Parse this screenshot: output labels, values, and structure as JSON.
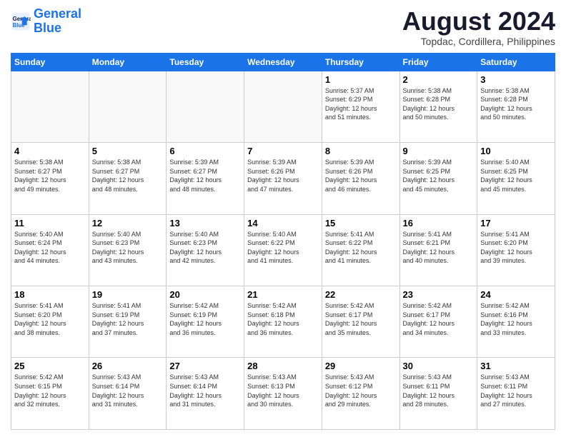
{
  "logo": {
    "line1": "General",
    "line2": "Blue"
  },
  "title": "August 2024",
  "subtitle": "Topdac, Cordillera, Philippines",
  "weekdays": [
    "Sunday",
    "Monday",
    "Tuesday",
    "Wednesday",
    "Thursday",
    "Friday",
    "Saturday"
  ],
  "weeks": [
    [
      {
        "day": "",
        "info": ""
      },
      {
        "day": "",
        "info": ""
      },
      {
        "day": "",
        "info": ""
      },
      {
        "day": "",
        "info": ""
      },
      {
        "day": "1",
        "info": "Sunrise: 5:37 AM\nSunset: 6:29 PM\nDaylight: 12 hours\nand 51 minutes."
      },
      {
        "day": "2",
        "info": "Sunrise: 5:38 AM\nSunset: 6:28 PM\nDaylight: 12 hours\nand 50 minutes."
      },
      {
        "day": "3",
        "info": "Sunrise: 5:38 AM\nSunset: 6:28 PM\nDaylight: 12 hours\nand 50 minutes."
      }
    ],
    [
      {
        "day": "4",
        "info": "Sunrise: 5:38 AM\nSunset: 6:27 PM\nDaylight: 12 hours\nand 49 minutes."
      },
      {
        "day": "5",
        "info": "Sunrise: 5:38 AM\nSunset: 6:27 PM\nDaylight: 12 hours\nand 48 minutes."
      },
      {
        "day": "6",
        "info": "Sunrise: 5:39 AM\nSunset: 6:27 PM\nDaylight: 12 hours\nand 48 minutes."
      },
      {
        "day": "7",
        "info": "Sunrise: 5:39 AM\nSunset: 6:26 PM\nDaylight: 12 hours\nand 47 minutes."
      },
      {
        "day": "8",
        "info": "Sunrise: 5:39 AM\nSunset: 6:26 PM\nDaylight: 12 hours\nand 46 minutes."
      },
      {
        "day": "9",
        "info": "Sunrise: 5:39 AM\nSunset: 6:25 PM\nDaylight: 12 hours\nand 45 minutes."
      },
      {
        "day": "10",
        "info": "Sunrise: 5:40 AM\nSunset: 6:25 PM\nDaylight: 12 hours\nand 45 minutes."
      }
    ],
    [
      {
        "day": "11",
        "info": "Sunrise: 5:40 AM\nSunset: 6:24 PM\nDaylight: 12 hours\nand 44 minutes."
      },
      {
        "day": "12",
        "info": "Sunrise: 5:40 AM\nSunset: 6:23 PM\nDaylight: 12 hours\nand 43 minutes."
      },
      {
        "day": "13",
        "info": "Sunrise: 5:40 AM\nSunset: 6:23 PM\nDaylight: 12 hours\nand 42 minutes."
      },
      {
        "day": "14",
        "info": "Sunrise: 5:40 AM\nSunset: 6:22 PM\nDaylight: 12 hours\nand 41 minutes."
      },
      {
        "day": "15",
        "info": "Sunrise: 5:41 AM\nSunset: 6:22 PM\nDaylight: 12 hours\nand 41 minutes."
      },
      {
        "day": "16",
        "info": "Sunrise: 5:41 AM\nSunset: 6:21 PM\nDaylight: 12 hours\nand 40 minutes."
      },
      {
        "day": "17",
        "info": "Sunrise: 5:41 AM\nSunset: 6:20 PM\nDaylight: 12 hours\nand 39 minutes."
      }
    ],
    [
      {
        "day": "18",
        "info": "Sunrise: 5:41 AM\nSunset: 6:20 PM\nDaylight: 12 hours\nand 38 minutes."
      },
      {
        "day": "19",
        "info": "Sunrise: 5:41 AM\nSunset: 6:19 PM\nDaylight: 12 hours\nand 37 minutes."
      },
      {
        "day": "20",
        "info": "Sunrise: 5:42 AM\nSunset: 6:19 PM\nDaylight: 12 hours\nand 36 minutes."
      },
      {
        "day": "21",
        "info": "Sunrise: 5:42 AM\nSunset: 6:18 PM\nDaylight: 12 hours\nand 36 minutes."
      },
      {
        "day": "22",
        "info": "Sunrise: 5:42 AM\nSunset: 6:17 PM\nDaylight: 12 hours\nand 35 minutes."
      },
      {
        "day": "23",
        "info": "Sunrise: 5:42 AM\nSunset: 6:17 PM\nDaylight: 12 hours\nand 34 minutes."
      },
      {
        "day": "24",
        "info": "Sunrise: 5:42 AM\nSunset: 6:16 PM\nDaylight: 12 hours\nand 33 minutes."
      }
    ],
    [
      {
        "day": "25",
        "info": "Sunrise: 5:42 AM\nSunset: 6:15 PM\nDaylight: 12 hours\nand 32 minutes."
      },
      {
        "day": "26",
        "info": "Sunrise: 5:43 AM\nSunset: 6:14 PM\nDaylight: 12 hours\nand 31 minutes."
      },
      {
        "day": "27",
        "info": "Sunrise: 5:43 AM\nSunset: 6:14 PM\nDaylight: 12 hours\nand 31 minutes."
      },
      {
        "day": "28",
        "info": "Sunrise: 5:43 AM\nSunset: 6:13 PM\nDaylight: 12 hours\nand 30 minutes."
      },
      {
        "day": "29",
        "info": "Sunrise: 5:43 AM\nSunset: 6:12 PM\nDaylight: 12 hours\nand 29 minutes."
      },
      {
        "day": "30",
        "info": "Sunrise: 5:43 AM\nSunset: 6:11 PM\nDaylight: 12 hours\nand 28 minutes."
      },
      {
        "day": "31",
        "info": "Sunrise: 5:43 AM\nSunset: 6:11 PM\nDaylight: 12 hours\nand 27 minutes."
      }
    ]
  ]
}
